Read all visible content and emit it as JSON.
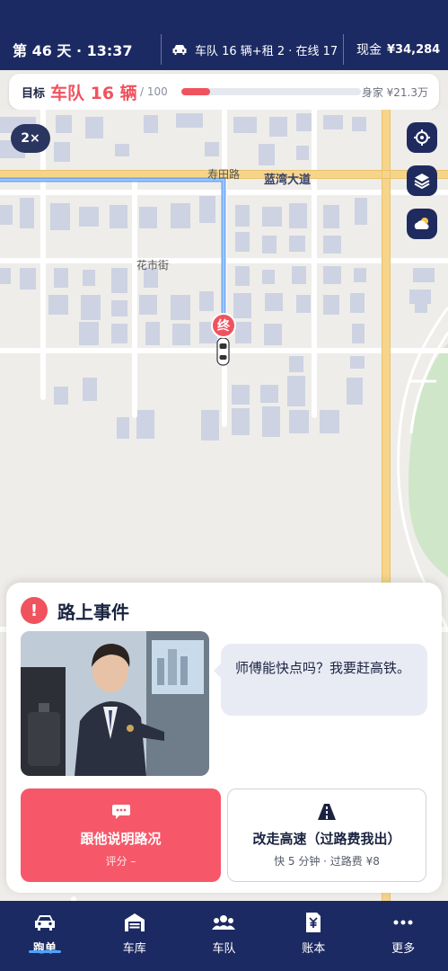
{
  "header": {
    "day_time": "第 46 天 · 13:37",
    "fleet_status": "车队 16 辆+租 2 · 在线 17",
    "cash_label": "现金",
    "cash_value": "¥34,284"
  },
  "goal": {
    "label": "目标",
    "current": "车队 16 辆",
    "total": "/ 100",
    "progress": 0.16,
    "net_worth": "身家 ¥21.3万"
  },
  "map": {
    "zoom": "2×",
    "streets": [
      "寿田路",
      "蓝湾大道",
      "花市街"
    ],
    "destination_marker": "终",
    "buttons": [
      "locate-icon",
      "layers-icon",
      "weather-icon"
    ]
  },
  "event": {
    "title": "路上事件",
    "alert_icon": "!",
    "message": "师傅能快点吗？我要赶高铁。",
    "options": [
      {
        "label": "跟他说明路况",
        "sub": "评分 –",
        "icon": "chat-icon"
      },
      {
        "label": "改走高速（过路费我出）",
        "sub": "快 5 分钟 · 过路费 ¥8",
        "icon": "road-icon"
      }
    ]
  },
  "nav": {
    "items": [
      {
        "label": "跑单",
        "icon": "car-icon"
      },
      {
        "label": "车库",
        "icon": "garage-icon"
      },
      {
        "label": "车队",
        "icon": "team-icon"
      },
      {
        "label": "账本",
        "icon": "ledger-icon"
      },
      {
        "label": "更多",
        "icon": "more-icon"
      }
    ],
    "active": "跑单"
  },
  "colors": {
    "primary": "#1c2a63",
    "accent": "#f0525e",
    "route": "#5b9cf0"
  }
}
